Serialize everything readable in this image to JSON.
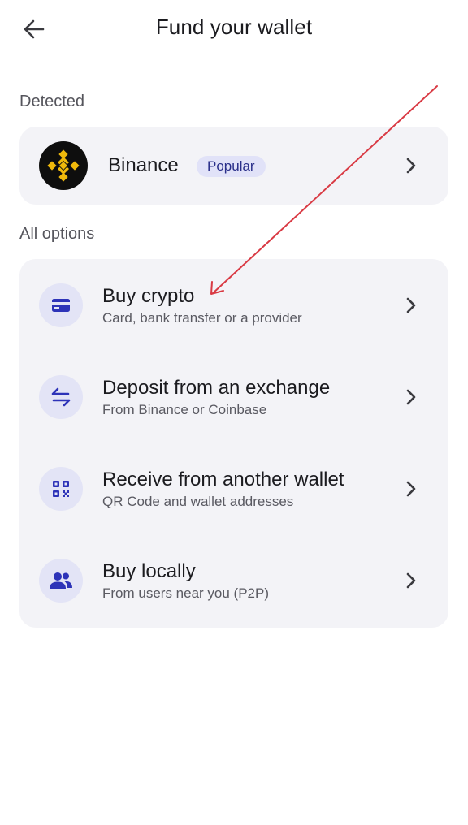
{
  "header": {
    "title": "Fund your wallet",
    "back_icon": "arrow-left-icon"
  },
  "detected": {
    "section_label": "Detected",
    "provider": {
      "name": "Binance",
      "badge": "Popular",
      "logo_icon": "binance-logo-icon"
    }
  },
  "all_options": {
    "section_label": "All options",
    "items": [
      {
        "title": "Buy crypto",
        "subtitle": "Card, bank transfer or a provider",
        "icon": "credit-card-icon"
      },
      {
        "title": "Deposit from an exchange",
        "subtitle": "From Binance or Coinbase",
        "icon": "swap-arrows-icon"
      },
      {
        "title": "Receive from another wallet",
        "subtitle": "QR Code and wallet addresses",
        "icon": "qr-code-icon"
      },
      {
        "title": "Buy locally",
        "subtitle": "From users near you (P2P)",
        "icon": "users-icon"
      }
    ]
  },
  "colors": {
    "accent": "#2d33b8",
    "card_background": "#f3f3f7",
    "icon_circle": "#e3e4f6",
    "binance_yellow": "#f0b90b",
    "annotation_red": "#d93a44"
  }
}
